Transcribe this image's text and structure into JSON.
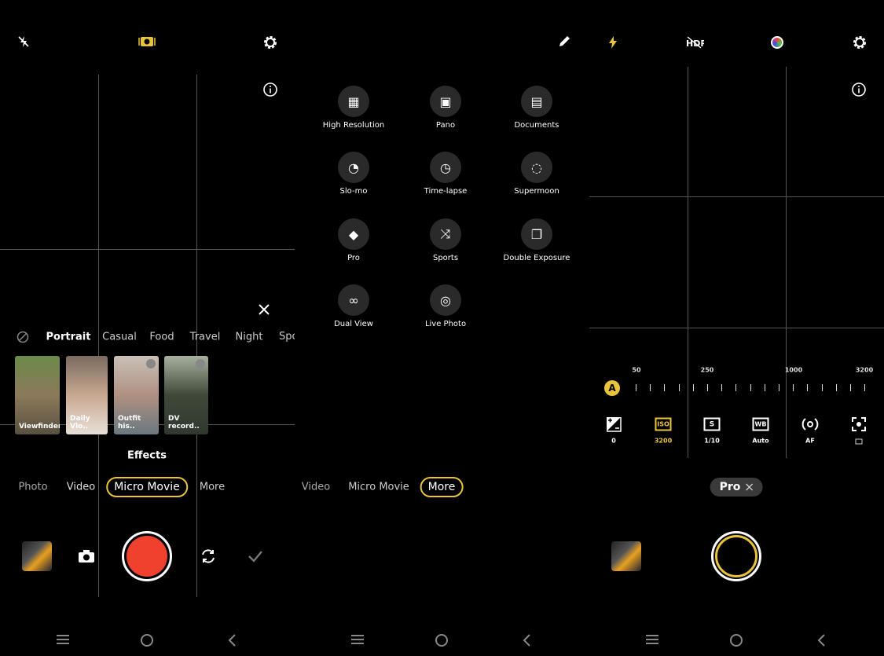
{
  "panel1": {
    "top_icons": [
      "flash-off-icon",
      "camera-mode-icon",
      "settings-icon"
    ],
    "filters": [
      "Portrait",
      "Casual",
      "Food",
      "Travel",
      "Night",
      "Spo"
    ],
    "templates": [
      "Viewfinder",
      "Daily Vlo..",
      "Outfit his..",
      "DV record.."
    ],
    "effects_label": "Effects",
    "modes": [
      "Photo",
      "Video",
      "Micro Movie",
      "More"
    ],
    "active_mode": "Micro Movie"
  },
  "panel2": {
    "camera_modes": [
      {
        "label": "High Resolution",
        "icon": "grid-icon"
      },
      {
        "label": "Pano",
        "icon": "panorama-icon"
      },
      {
        "label": "Documents",
        "icon": "document-icon"
      },
      {
        "label": "Slo-mo",
        "icon": "slow-motion-icon"
      },
      {
        "label": "Time-lapse",
        "icon": "timelapse-icon"
      },
      {
        "label": "Supermoon",
        "icon": "moon-icon"
      },
      {
        "label": "Pro",
        "icon": "pro-icon"
      },
      {
        "label": "Sports",
        "icon": "sports-icon"
      },
      {
        "label": "Double Exposure",
        "icon": "double-exposure-icon"
      },
      {
        "label": "Dual View",
        "icon": "dual-view-icon"
      },
      {
        "label": "Live Photo",
        "icon": "live-photo-icon"
      }
    ],
    "modes": [
      "Video",
      "Micro Movie",
      "More"
    ],
    "active_mode": "More"
  },
  "panel3": {
    "iso_scale": [
      "50",
      "250",
      "1000",
      "3200"
    ],
    "auto_badge": "A",
    "controls": [
      {
        "name": "exposure",
        "value": "0"
      },
      {
        "name": "ISO",
        "value": "3200",
        "active": true
      },
      {
        "name": "S",
        "value": "1/10"
      },
      {
        "name": "WB",
        "value": "Auto"
      },
      {
        "name": "focus",
        "value": "AF"
      },
      {
        "name": "metering",
        "value": ""
      }
    ],
    "iso_label": "ISO",
    "s_label": "S",
    "wb_label": "WB",
    "mode_pill": "Pro"
  },
  "colors": {
    "accent": "#e9c33a",
    "shutter_red": "#f0412f",
    "background": "#000000"
  }
}
